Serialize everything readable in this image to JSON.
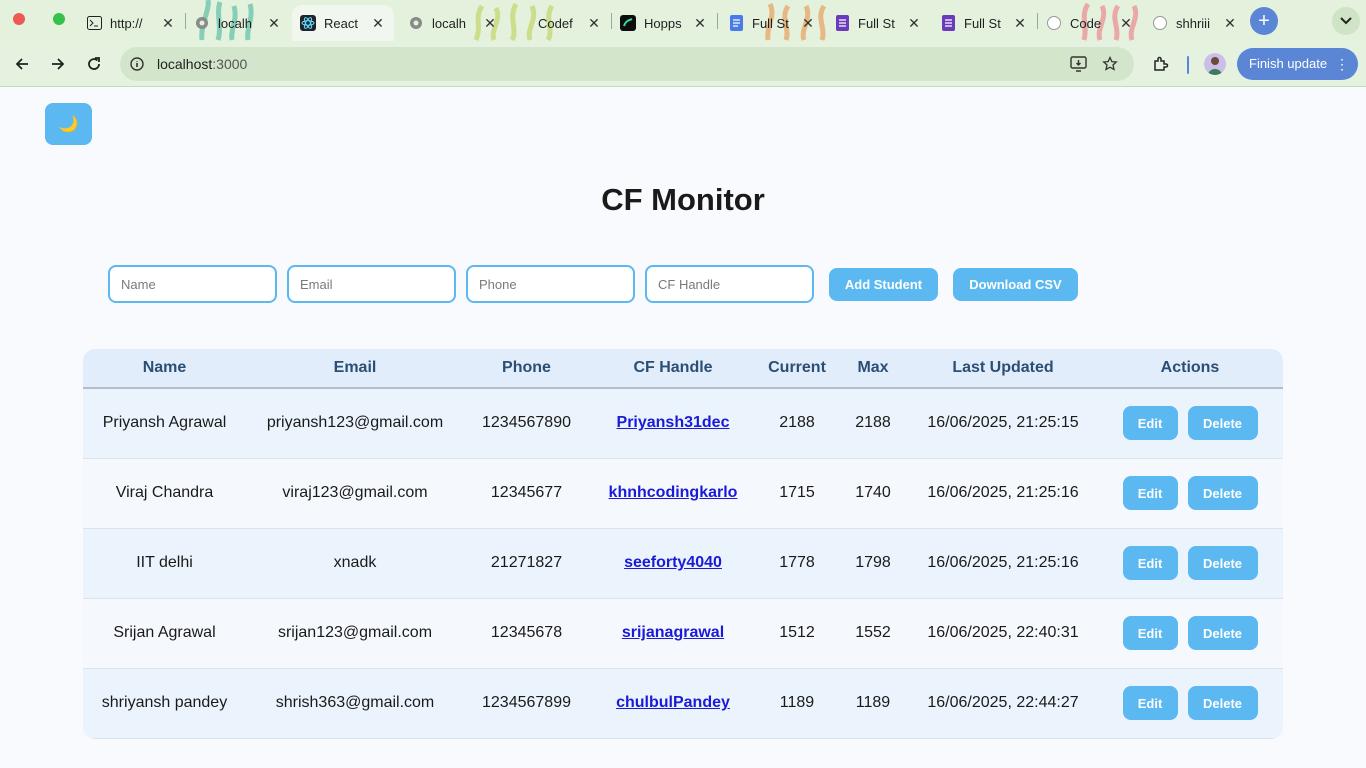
{
  "browser": {
    "tabs": [
      {
        "title": "http://",
        "icon": "terminal-icon"
      },
      {
        "title": "localh",
        "icon": "globe-icon"
      },
      {
        "title": "React",
        "icon": "react-icon"
      },
      {
        "title": "localh",
        "icon": "globe-icon"
      },
      {
        "title": "Codef",
        "icon": "codeforces-icon"
      },
      {
        "title": "Hopps",
        "icon": "hoppscotch-icon"
      },
      {
        "title": "Full St",
        "icon": "docs-icon"
      },
      {
        "title": "Full St",
        "icon": "forms-icon"
      },
      {
        "title": "Full St",
        "icon": "forms-icon"
      },
      {
        "title": "Code",
        "icon": "github-icon"
      },
      {
        "title": "shhriii",
        "icon": "github-icon"
      }
    ],
    "address": {
      "host": "localhost",
      "port": ":3000"
    },
    "finish_update": "Finish update",
    "accent": "#5b86d6"
  },
  "app": {
    "theme_toggle": "🌙",
    "title": "CF Monitor",
    "form": {
      "name_placeholder": "Name",
      "email_placeholder": "Email",
      "phone_placeholder": "Phone",
      "handle_placeholder": "CF Handle",
      "add_button": "Add Student",
      "csv_button": "Download CSV"
    },
    "table": {
      "headers": [
        "Name",
        "Email",
        "Phone",
        "CF Handle",
        "Current",
        "Max",
        "Last Updated",
        "Actions"
      ],
      "edit_label": "Edit",
      "delete_label": "Delete",
      "rows": [
        {
          "name": "Priyansh Agrawal",
          "email": "priyansh123@gmail.com",
          "phone": "1234567890",
          "handle": "Priyansh31dec",
          "current": "2188",
          "max": "2188",
          "updated": "16/06/2025, 21:25:15"
        },
        {
          "name": "Viraj Chandra",
          "email": "viraj123@gmail.com",
          "phone": "12345677",
          "handle": "khnhcodingkarlo",
          "current": "1715",
          "max": "1740",
          "updated": "16/06/2025, 21:25:16"
        },
        {
          "name": "IIT delhi",
          "email": "xnadk",
          "phone": "21271827",
          "handle": "seeforty4040",
          "current": "1778",
          "max": "1798",
          "updated": "16/06/2025, 21:25:16"
        },
        {
          "name": "Srijan Agrawal",
          "email": "srijan123@gmail.com",
          "phone": "12345678",
          "handle": "srijanagrawal",
          "current": "1512",
          "max": "1552",
          "updated": "16/06/2025, 22:40:31"
        },
        {
          "name": "shriyansh pandey",
          "email": "shrish363@gmail.com",
          "phone": "1234567899",
          "handle": "chulbulPandey",
          "current": "1189",
          "max": "1189",
          "updated": "16/06/2025, 22:44:27"
        }
      ]
    },
    "accent": "#5bb8f0"
  }
}
